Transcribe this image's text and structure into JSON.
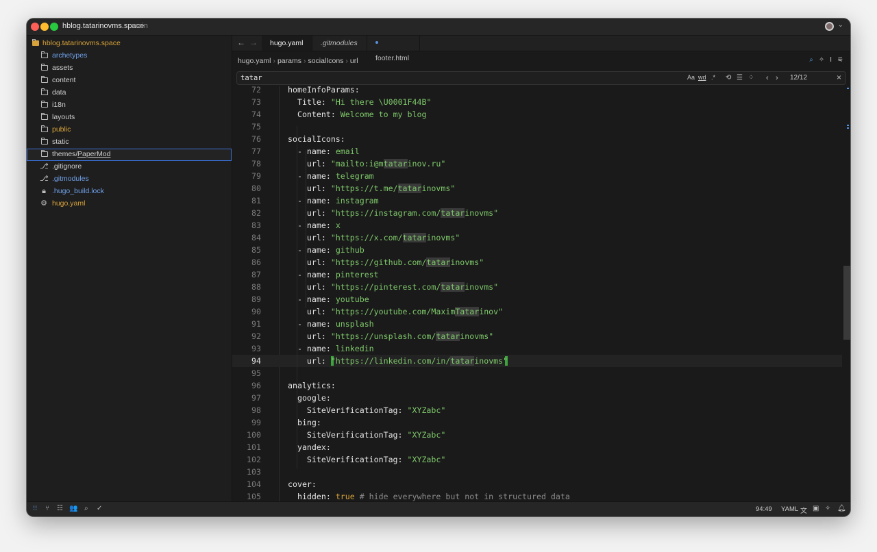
{
  "titlebar": {
    "project": "hblog.tatarinovms.space",
    "branch": "main"
  },
  "sidebar": {
    "root": "hblog.tatarinovms.space",
    "items": [
      {
        "label": "archetypes",
        "color": "#6fa0e8",
        "icon": "folder-icon"
      },
      {
        "label": "assets",
        "color": "#cfcfcf",
        "icon": "folder-icon"
      },
      {
        "label": "content",
        "color": "#cfcfcf",
        "icon": "folder-icon"
      },
      {
        "label": "data",
        "color": "#cfcfcf",
        "icon": "folder-icon"
      },
      {
        "label": "i18n",
        "color": "#cfcfcf",
        "icon": "folder-icon"
      },
      {
        "label": "layouts",
        "color": "#cfcfcf",
        "icon": "folder-icon"
      },
      {
        "label": "public",
        "color": "#d7a33a",
        "icon": "folder-icon"
      },
      {
        "label": "static",
        "color": "#cfcfcf",
        "icon": "folder-icon"
      },
      {
        "label": "themes/",
        "suffix": "PaperMod",
        "color": "#cfcfcf",
        "icon": "folder-icon"
      },
      {
        "label": ".gitignore",
        "color": "#cfcfcf",
        "icon": "git-icon"
      },
      {
        "label": ".gitmodules",
        "color": "#6fa0e8",
        "icon": "git-icon"
      },
      {
        "label": ".hugo_build.lock",
        "color": "#6fa0e8",
        "icon": "lock-icon"
      },
      {
        "label": "hugo.yaml",
        "color": "#d7a33a",
        "icon": "gear-icon"
      }
    ]
  },
  "tabs": [
    {
      "label": "hugo.yaml",
      "active": true
    },
    {
      "label": ".gitmodules",
      "italic": true
    },
    {
      "label": "footer.html",
      "modified": true
    }
  ],
  "breadcrumb": [
    "hugo.yaml",
    "params",
    "socialIcons",
    "url"
  ],
  "find": {
    "query": "tatar",
    "case_label": "Aa",
    "word_label": "wd",
    "regex_label": ".*",
    "count": "12/12"
  },
  "status": {
    "position": "94:49",
    "language": "YAML"
  },
  "code": [
    {
      "n": "72",
      "tokens": [
        [
          "k",
          "homeInfoParams:"
        ]
      ]
    },
    {
      "n": "73",
      "tokens": [
        [
          "p",
          "  "
        ],
        [
          "k",
          "Title: "
        ],
        [
          "s",
          "\"Hi there \\U0001F44B\""
        ]
      ]
    },
    {
      "n": "74",
      "tokens": [
        [
          "p",
          "  "
        ],
        [
          "k",
          "Content: "
        ],
        [
          "s",
          "Welcome to my blog"
        ]
      ]
    },
    {
      "n": "75",
      "tokens": []
    },
    {
      "n": "76",
      "tokens": [
        [
          "k",
          "socialIcons:"
        ]
      ]
    },
    {
      "n": "77",
      "tokens": [
        [
          "p",
          "  - "
        ],
        [
          "k",
          "name: "
        ],
        [
          "s",
          "email"
        ]
      ]
    },
    {
      "n": "78",
      "tokens": [
        [
          "p",
          "    "
        ],
        [
          "k",
          "url: "
        ],
        [
          "s",
          "\"mailto:i@m"
        ],
        [
          "sm",
          "tatar"
        ],
        [
          "s",
          "inov.ru\""
        ]
      ]
    },
    {
      "n": "79",
      "tokens": [
        [
          "p",
          "  - "
        ],
        [
          "k",
          "name: "
        ],
        [
          "s",
          "telegram"
        ]
      ]
    },
    {
      "n": "80",
      "tokens": [
        [
          "p",
          "    "
        ],
        [
          "k",
          "url: "
        ],
        [
          "s",
          "\"https://t.me/"
        ],
        [
          "sm",
          "tatar"
        ],
        [
          "s",
          "inovms\""
        ]
      ]
    },
    {
      "n": "81",
      "tokens": [
        [
          "p",
          "  - "
        ],
        [
          "k",
          "name: "
        ],
        [
          "s",
          "instagram"
        ]
      ]
    },
    {
      "n": "82",
      "tokens": [
        [
          "p",
          "    "
        ],
        [
          "k",
          "url: "
        ],
        [
          "s",
          "\"https://instagram.com/"
        ],
        [
          "sm",
          "tatar"
        ],
        [
          "s",
          "inovms\""
        ]
      ]
    },
    {
      "n": "83",
      "tokens": [
        [
          "p",
          "  - "
        ],
        [
          "k",
          "name: "
        ],
        [
          "s",
          "x"
        ]
      ]
    },
    {
      "n": "84",
      "tokens": [
        [
          "p",
          "    "
        ],
        [
          "k",
          "url: "
        ],
        [
          "s",
          "\"https://x.com/"
        ],
        [
          "sm",
          "tatar"
        ],
        [
          "s",
          "inovms\""
        ]
      ]
    },
    {
      "n": "85",
      "tokens": [
        [
          "p",
          "  - "
        ],
        [
          "k",
          "name: "
        ],
        [
          "s",
          "github"
        ]
      ]
    },
    {
      "n": "86",
      "tokens": [
        [
          "p",
          "    "
        ],
        [
          "k",
          "url: "
        ],
        [
          "s",
          "\"https://github.com/"
        ],
        [
          "sm",
          "tatar"
        ],
        [
          "s",
          "inovms\""
        ]
      ]
    },
    {
      "n": "87",
      "tokens": [
        [
          "p",
          "  - "
        ],
        [
          "k",
          "name: "
        ],
        [
          "s",
          "pinterest"
        ]
      ]
    },
    {
      "n": "88",
      "tokens": [
        [
          "p",
          "    "
        ],
        [
          "k",
          "url: "
        ],
        [
          "s",
          "\"https://pinterest.com/"
        ],
        [
          "sm",
          "tatar"
        ],
        [
          "s",
          "inovms\""
        ]
      ]
    },
    {
      "n": "89",
      "tokens": [
        [
          "p",
          "  - "
        ],
        [
          "k",
          "name: "
        ],
        [
          "s",
          "youtube"
        ]
      ]
    },
    {
      "n": "90",
      "tokens": [
        [
          "p",
          "    "
        ],
        [
          "k",
          "url: "
        ],
        [
          "s",
          "\"https://youtube.com/Maxim"
        ],
        [
          "sm",
          "Tatar"
        ],
        [
          "s",
          "inov\""
        ]
      ]
    },
    {
      "n": "91",
      "tokens": [
        [
          "p",
          "  - "
        ],
        [
          "k",
          "name: "
        ],
        [
          "s",
          "unsplash"
        ]
      ]
    },
    {
      "n": "92",
      "tokens": [
        [
          "p",
          "    "
        ],
        [
          "k",
          "url: "
        ],
        [
          "s",
          "\"https://unsplash.com/"
        ],
        [
          "sm",
          "tatar"
        ],
        [
          "s",
          "inovms\""
        ]
      ]
    },
    {
      "n": "93",
      "tokens": [
        [
          "p",
          "  - "
        ],
        [
          "k",
          "name: "
        ],
        [
          "s",
          "linkedin"
        ]
      ]
    },
    {
      "n": "94",
      "current": true,
      "tokens": [
        [
          "p",
          "    "
        ],
        [
          "k",
          "url: "
        ],
        [
          "s",
          "\"https://linkedin.com/in/"
        ],
        [
          "sm",
          "tatar"
        ],
        [
          "s",
          "inovms\""
        ]
      ]
    },
    {
      "n": "95",
      "tokens": []
    },
    {
      "n": "96",
      "tokens": [
        [
          "k",
          "analytics:"
        ]
      ]
    },
    {
      "n": "97",
      "tokens": [
        [
          "p",
          "  "
        ],
        [
          "k",
          "google:"
        ]
      ]
    },
    {
      "n": "98",
      "tokens": [
        [
          "p",
          "    "
        ],
        [
          "k",
          "SiteVerificationTag: "
        ],
        [
          "s",
          "\"XYZabc\""
        ]
      ]
    },
    {
      "n": "99",
      "tokens": [
        [
          "p",
          "  "
        ],
        [
          "k",
          "bing:"
        ]
      ]
    },
    {
      "n": "100",
      "tokens": [
        [
          "p",
          "    "
        ],
        [
          "k",
          "SiteVerificationTag: "
        ],
        [
          "s",
          "\"XYZabc\""
        ]
      ]
    },
    {
      "n": "101",
      "tokens": [
        [
          "p",
          "  "
        ],
        [
          "k",
          "yandex:"
        ]
      ]
    },
    {
      "n": "102",
      "tokens": [
        [
          "p",
          "    "
        ],
        [
          "k",
          "SiteVerificationTag: "
        ],
        [
          "s",
          "\"XYZabc\""
        ]
      ]
    },
    {
      "n": "103",
      "tokens": []
    },
    {
      "n": "104",
      "tokens": [
        [
          "k",
          "cover:"
        ]
      ]
    },
    {
      "n": "105",
      "tokens": [
        [
          "p",
          "  "
        ],
        [
          "k",
          "hidden: "
        ],
        [
          "b",
          "true"
        ],
        [
          "c",
          " # hide everywhere but not in structured data"
        ]
      ]
    }
  ]
}
